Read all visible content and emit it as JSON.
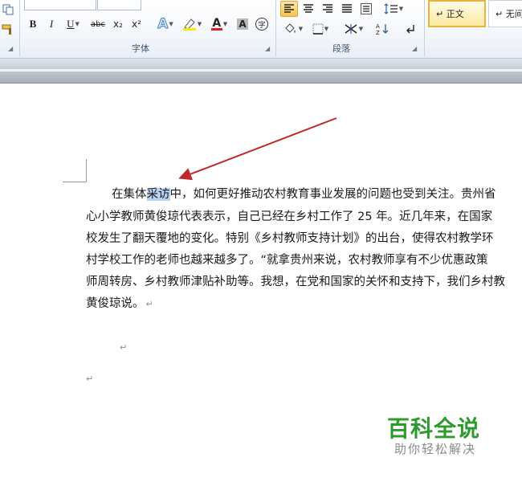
{
  "ribbon": {
    "font_group_label": "字体",
    "paragraph_group_label": "段落",
    "styles": [
      "↵ 正文",
      "↵ 无间"
    ],
    "font_buttons": {
      "bold": "B",
      "italic": "I",
      "underline": "U",
      "strikethrough": "abc",
      "subscript": "x₂",
      "superscript": "x²",
      "text_effect": "A",
      "font_color": "A",
      "char_shading": "A",
      "enclose_char": "字"
    }
  },
  "document": {
    "paragraph_lines": [
      {
        "before": "在集体",
        "selected": "采访",
        "after": "中，如何更好推动农村教育事业发展的问题也受到关注。贵州省"
      },
      {
        "text": "心小学教师黄俊琼代表表示，自己已经在乡村工作了 25 年。近几年来，在国家"
      },
      {
        "text": "校发生了翻天覆地的变化。特别《乡村教师支持计划》的出台，使得农村教学环"
      },
      {
        "text": "村学校工作的老师也越来越多了。“就拿贵州来说，农村教师享有不少优惠政策"
      },
      {
        "text": "师周转房、乡村教师津贴补助等。我想，在党和国家的关怀和支持下，我们乡村教"
      },
      {
        "text": "黄俊琼说。"
      }
    ],
    "paragraph_mark": "↵"
  },
  "annotation": {
    "arrow_color": "#c0282a"
  },
  "watermark": {
    "title": "百科全说",
    "subtitle": "助你轻松解决"
  }
}
